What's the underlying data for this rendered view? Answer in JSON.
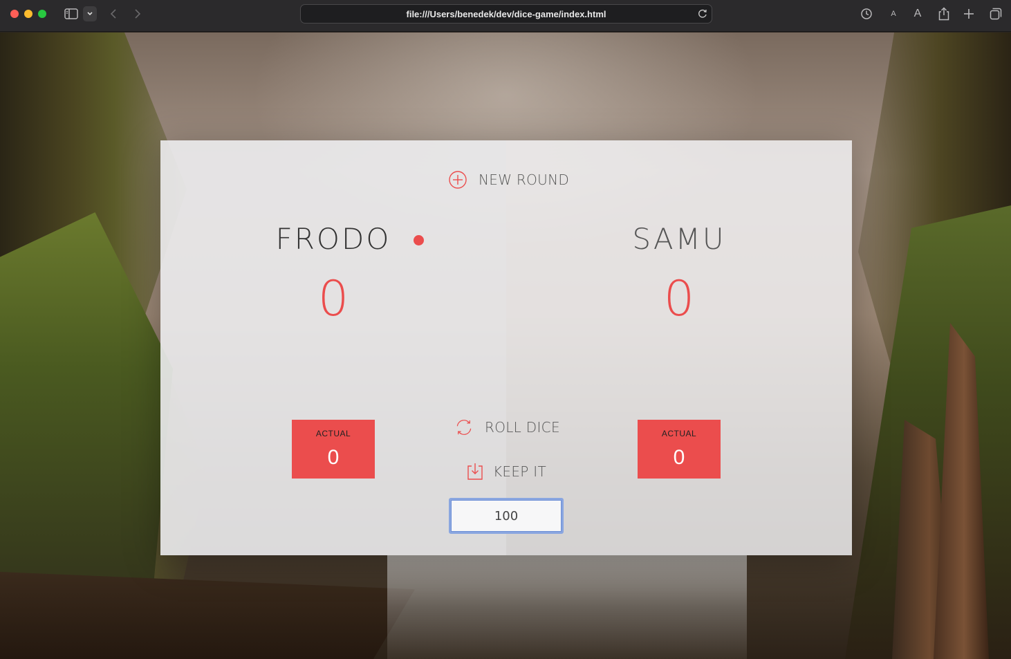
{
  "browser": {
    "url": "file:///Users/benedek/dev/dice-game/index.html",
    "icons": {
      "sidebar": "sidebar-icon",
      "back": "chevron-left-icon",
      "forward": "chevron-right-icon",
      "reload": "reload-icon",
      "history": "history-icon",
      "font_small": "A",
      "font_large": "A",
      "share": "share-icon",
      "new_tab": "plus-icon",
      "tabs": "tab-overview-icon"
    }
  },
  "game": {
    "new_game_label": "NEW ROUND",
    "roll_label": "ROLL DICE",
    "hold_label": "KEEP IT",
    "final_score_value": "100",
    "accent_color": "#eb4d4d",
    "players": [
      {
        "name": "FRODO",
        "score": "0",
        "current_label": "ACTUAL",
        "current": "0",
        "active": true
      },
      {
        "name": "SAMU",
        "score": "0",
        "current_label": "ACTUAL",
        "current": "0",
        "active": false
      }
    ]
  }
}
